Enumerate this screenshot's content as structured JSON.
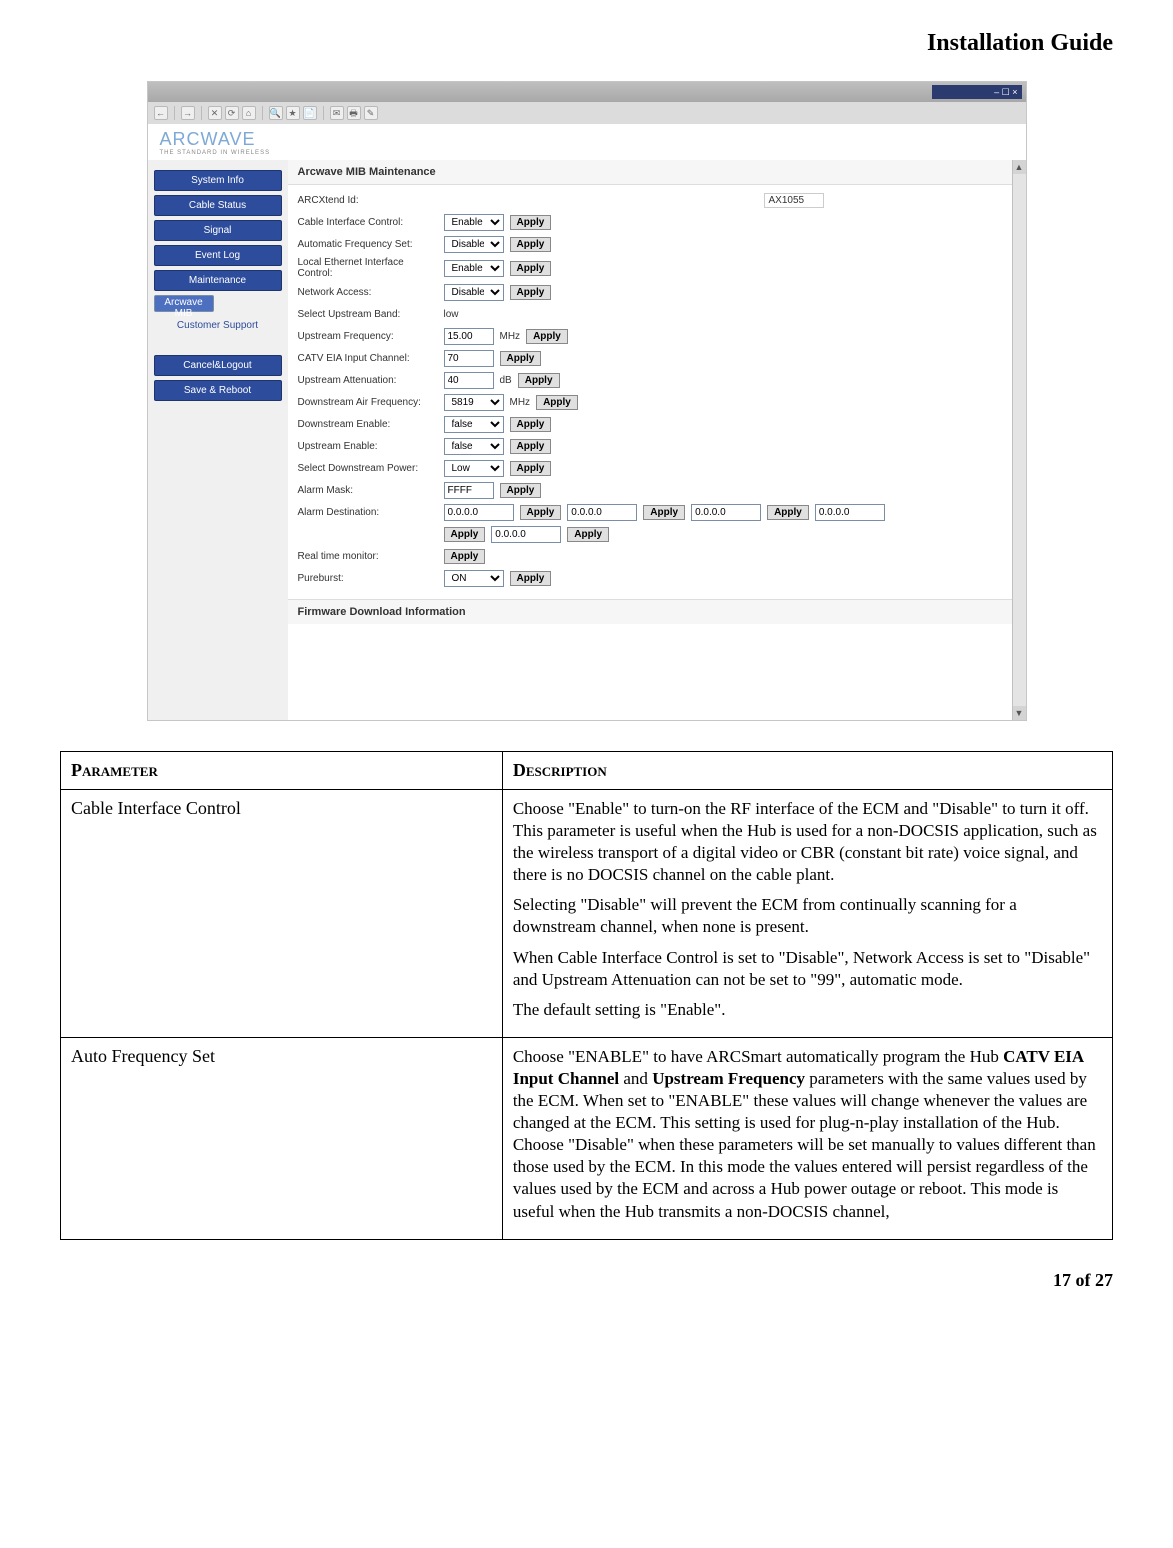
{
  "page": {
    "title": "Installation Guide",
    "footer": "17 of 27"
  },
  "titlebar": {
    "indicator": "– ☐ ×"
  },
  "toolbar": {
    "back": "←",
    "fwd": "→",
    "stop": "✕",
    "refresh": "⟳",
    "home": "⌂",
    "search": "🔍",
    "fav": "★",
    "hist": "📄",
    "mail": "✉",
    "print": "🖶",
    "edit": "✎"
  },
  "logo": {
    "text": "ARCWAVE",
    "sub": "THE STANDARD IN WIRELESS"
  },
  "sidebar": {
    "items": [
      {
        "label": "System Info",
        "sel": false
      },
      {
        "label": "Cable Status",
        "sel": false
      },
      {
        "label": "Signal",
        "sel": false
      },
      {
        "label": "Event Log",
        "sel": false
      },
      {
        "label": "Maintenance",
        "sel": false
      },
      {
        "label": "Arcwave MIB",
        "sel": true
      }
    ],
    "support": "Customer Support",
    "actions": [
      {
        "label": "Cancel&Logout"
      },
      {
        "label": "Save & Reboot"
      }
    ]
  },
  "panel": {
    "title": "Arcwave MIB Maintenance",
    "arcxtend_label": "ARCXtend Id:",
    "arcxtend_value": "AX1055",
    "rows": {
      "cic": {
        "label": "Cable Interface Control:",
        "value": "Enable"
      },
      "afs": {
        "label": "Automatic Frequency Set:",
        "value": "Disable"
      },
      "lei": {
        "label": "Local Ethernet Interface Control:",
        "value": "Enable"
      },
      "na": {
        "label": "Network Access:",
        "value": "Disable"
      },
      "sub": {
        "label": "Select Upstream Band:",
        "value": "low"
      },
      "uf": {
        "label": "Upstream Frequency:",
        "value": "15.00",
        "unit": "MHz"
      },
      "cec": {
        "label": "CATV EIA Input Channel:",
        "value": "70"
      },
      "ua": {
        "label": "Upstream Attenuation:",
        "value": "40",
        "unit": "dB"
      },
      "daf": {
        "label": "Downstream Air Frequency:",
        "value": "5819",
        "unit": "MHz"
      },
      "de": {
        "label": "Downstream Enable:",
        "value": "false"
      },
      "ue": {
        "label": "Upstream Enable:",
        "value": "false"
      },
      "sdp": {
        "label": "Select Downstream Power:",
        "value": "Low"
      },
      "am": {
        "label": "Alarm Mask:",
        "value": "FFFF"
      },
      "ad": {
        "label": "Alarm Destination:",
        "v1": "0.0.0.0",
        "v2": "0.0.0.0",
        "v3": "0.0.0.0",
        "v4": "0.0.0.0",
        "v5": "0.0.0.0"
      },
      "rtm": {
        "label": "Real time monitor:"
      },
      "pb": {
        "label": "Pureburst:",
        "value": "ON"
      }
    },
    "apply": "Apply",
    "footer": "Firmware Download Information"
  },
  "table": {
    "col_param": "Parameter",
    "col_desc": "Description",
    "rows": [
      {
        "param": "Cable Interface Control",
        "desc": [
          "Choose \"Enable\" to turn-on the RF interface of the ECM and \"Disable\" to turn it off. This parameter is useful when the Hub is used for a non-DOCSIS application, such as the wireless transport of a digital video or CBR (constant bit rate) voice signal, and there is no DOCSIS channel on the cable plant.",
          "Selecting \"Disable\" will prevent the ECM from continually scanning for a downstream channel, when none is present.",
          "When Cable Interface Control is set to \"Disable\", Network Access is set to \"Disable\" and Upstream Attenuation can not be set to \"99\", automatic mode.",
          "The default setting is \"Enable\"."
        ]
      },
      {
        "param": "Auto Frequency Set",
        "desc": [
          "Choose \"ENABLE\" to have ARCSmart automatically program the Hub <b>CATV EIA Input Channel</b> and <b>Upstream Frequency</b> parameters with the same values used by the ECM. When set to \"ENABLE\" these values will change whenever the values are changed at the ECM. This setting is used for plug-n-play installation of the Hub. Choose \"Disable\" when these parameters will be set manually to values different than those used by the ECM. In this mode the values entered will persist regardless of the values used by the ECM and across a Hub power outage or reboot. This mode is useful when the Hub transmits a non-DOCSIS channel,"
        ]
      }
    ]
  }
}
